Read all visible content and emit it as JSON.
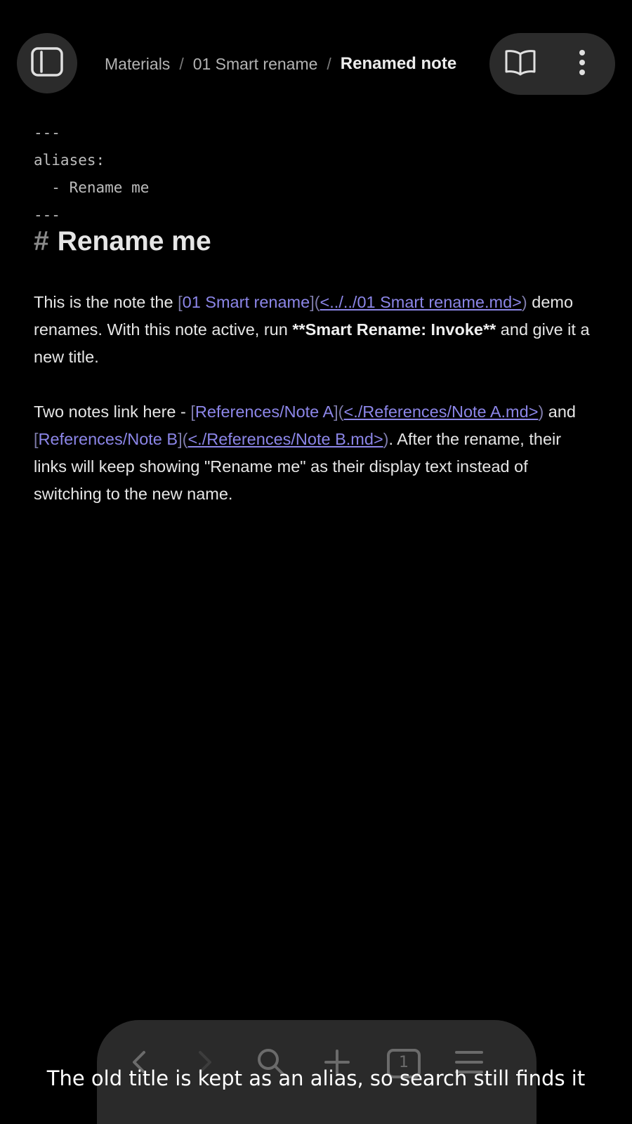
{
  "header": {
    "breadcrumb": {
      "items": [
        "Materials",
        "01 Smart rename"
      ],
      "separator": "/",
      "current": "Renamed note"
    },
    "icons": {
      "sidebar": "sidebar-toggle-icon",
      "reading_view": "book-open-icon",
      "more": "more-vertical-icon"
    }
  },
  "frontmatter": {
    "open": "---",
    "key": "aliases:",
    "item": "  - Rename me",
    "close": "---"
  },
  "heading": {
    "hash": "#",
    "text": "Rename me"
  },
  "paragraph1": {
    "t1": "This is the note the ",
    "link_open": "[",
    "link_text": "01 Smart rename",
    "link_close": "]",
    "paren_open": "(",
    "link_url": "<../../01 Smart rename.md>",
    "paren_close": ")",
    "t2": " demo renames. With this note active, run ",
    "bold": "**Smart Rename: Invoke**",
    "t3": " and give it a new title."
  },
  "paragraph2": {
    "t1": "Two notes link here - ",
    "a_open": "[",
    "a_text": "References/Note A",
    "a_close": "]",
    "a_paren_open": "(",
    "a_url": "<./References/Note A.md>",
    "a_paren_close": ")",
    "t2": " and ",
    "b_open": "[",
    "b_text": "References/Note B",
    "b_close": "]",
    "b_paren_open": "(",
    "b_url": "<./References/Note B.md>",
    "b_paren_close": ")",
    "t3": ". After the rename, their links will keep showing \"Rename me\" as their display text instead of switching to the new name."
  },
  "bottom_toolbar": {
    "icons": [
      "back-icon",
      "forward-icon",
      "search-icon",
      "plus-icon",
      "tabs-icon",
      "menu-icon"
    ],
    "tab_count": "1"
  },
  "caption": "The old title is kept as an alias, so search still finds it",
  "colors": {
    "background": "#000000",
    "text": "#e6e6e6",
    "link": "#8c86e8",
    "surface": "#2b2b2b"
  }
}
